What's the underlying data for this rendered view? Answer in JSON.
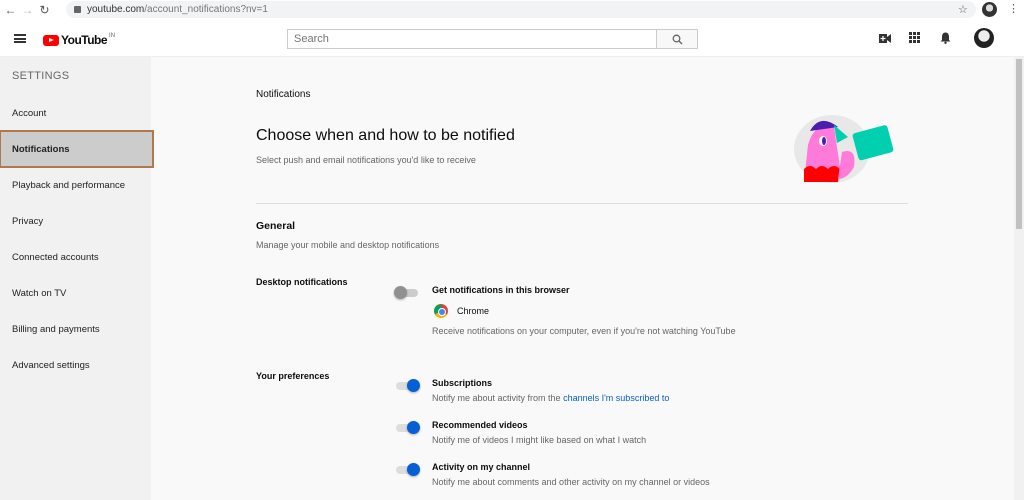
{
  "browser": {
    "url_host": "youtube.com",
    "url_path": "/account_notifications?nv=1"
  },
  "header": {
    "logo_text": "YouTube",
    "region": "IN",
    "search_placeholder": "Search"
  },
  "sidebar": {
    "title": "SETTINGS",
    "items": [
      {
        "label": "Account"
      },
      {
        "label": "Notifications",
        "selected": true
      },
      {
        "label": "Playback and performance"
      },
      {
        "label": "Privacy"
      },
      {
        "label": "Connected accounts"
      },
      {
        "label": "Watch on TV"
      },
      {
        "label": "Billing and payments"
      },
      {
        "label": "Advanced settings"
      }
    ]
  },
  "main": {
    "section_label": "Notifications",
    "title": "Choose when and how to be notified",
    "subtitle": "Select push and email notifications you'd like to receive",
    "general": {
      "title": "General",
      "subtitle": "Manage your mobile and desktop notifications"
    },
    "desktop": {
      "label": "Desktop notifications",
      "option_title": "Get notifications in this browser",
      "enabled": false,
      "browser_name": "Chrome",
      "description": "Receive notifications on your computer, even if you're not watching YouTube"
    },
    "preferences": {
      "label": "Your preferences",
      "items": [
        {
          "title": "Subscriptions",
          "desc": "Notify me about activity from the ",
          "link": "channels I'm subscribed to",
          "enabled": true
        },
        {
          "title": "Recommended videos",
          "desc": "Notify me of videos I might like based on what I watch",
          "enabled": true
        },
        {
          "title": "Activity on my channel",
          "desc": "Notify me about comments and other activity on my channel or videos",
          "enabled": true
        }
      ]
    }
  },
  "colors": {
    "accent": "#065fd4",
    "brand": "#ff0000"
  }
}
